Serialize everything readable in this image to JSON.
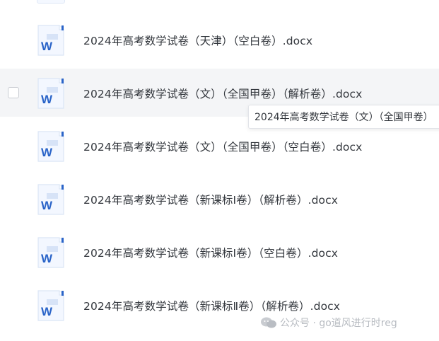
{
  "files": [
    {
      "name": "2024年高考数学试卷（天津）（空白卷）.docx",
      "icon": "word-document-icon"
    },
    {
      "name": "2024年高考数学试卷（文）（全国甲卷）（解析卷）.docx",
      "icon": "word-document-icon"
    },
    {
      "name": "2024年高考数学试卷（文）（全国甲卷）（空白卷）.docx",
      "icon": "word-document-icon"
    },
    {
      "name": "2024年高考数学试卷（新课标Ⅰ卷）（解析卷）.docx",
      "icon": "word-document-icon"
    },
    {
      "name": "2024年高考数学试卷（新课标Ⅰ卷）（空白卷）.docx",
      "icon": "word-document-icon"
    },
    {
      "name": "2024年高考数学试卷（新课标Ⅱ卷）（解析卷）.docx",
      "icon": "word-document-icon"
    }
  ],
  "tooltip": {
    "text": "2024年高考数学试卷（文）（全国甲卷）"
  },
  "watermark": {
    "text": "公众号 · go道风进行时reg"
  },
  "icon_letter": "W",
  "colors": {
    "word_blue": "#2a64c8",
    "hover_bg": "#f4f5f7"
  }
}
